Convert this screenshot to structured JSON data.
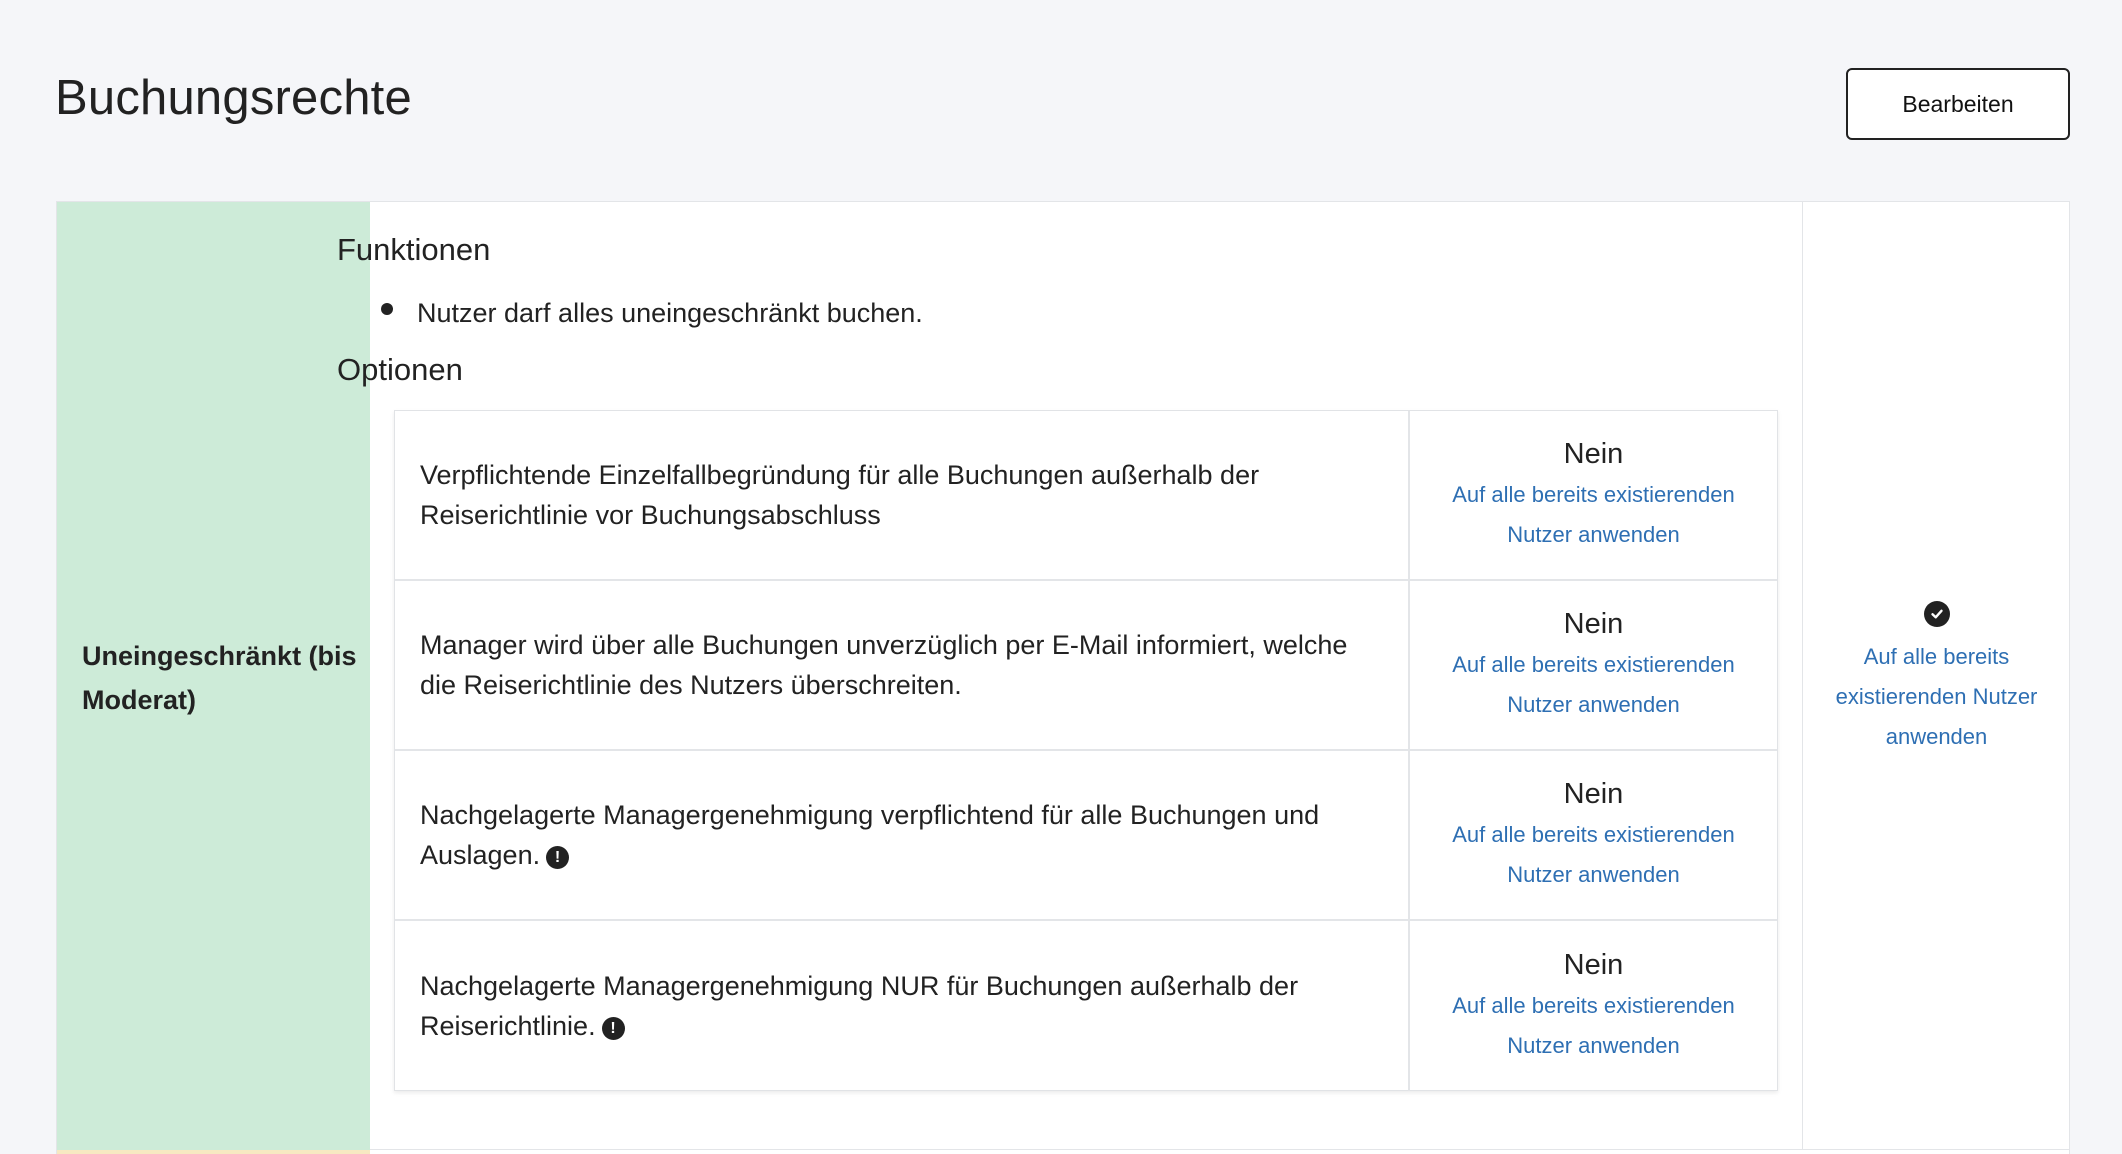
{
  "header": {
    "title": "Buchungsrechte",
    "edit_label": "Bearbeiten"
  },
  "level": {
    "label": "Uneingeschränkt (bis Moderat)",
    "color": "#cdebd8"
  },
  "functions": {
    "heading": "Funktionen",
    "items": [
      "Nutzer darf alles uneingeschränkt buchen."
    ]
  },
  "options": {
    "heading": "Optionen",
    "rows": [
      {
        "text": "Verpflichtende Einzelfallbegründung für alle Buchungen außerhalb der Reiserichtlinie vor Buchungsabschluss",
        "value": "Nein",
        "link": "Auf alle bereits existierenden Nutzer anwenden",
        "info_icon": false
      },
      {
        "text": "Manager wird über alle Buchungen unverzüglich per E-Mail informiert, welche die Reiserichtlinie des Nutzers überschreiten.",
        "value": "Nein",
        "link": "Auf alle bereits existierenden Nutzer anwenden",
        "info_icon": false
      },
      {
        "text": "Nachgelagerte Managergenehmigung verpflichtend für alle Buchungen und Auslagen.",
        "value": "Nein",
        "link": "Auf alle bereits existierenden Nutzer anwenden",
        "info_icon": true
      },
      {
        "text": "Nachgelagerte Managergenehmigung NUR für Buchungen außerhalb der Reiserichtlinie.",
        "value": "Nein",
        "link": "Auf alle bereits existierenden Nutzer anwenden",
        "info_icon": true
      }
    ]
  },
  "status": {
    "icon": "check-circle-icon",
    "link": "Auf alle bereits existierenden Nutzer anwenden"
  },
  "colors": {
    "link": "#2e6fb3",
    "background": "#f5f6f9"
  }
}
